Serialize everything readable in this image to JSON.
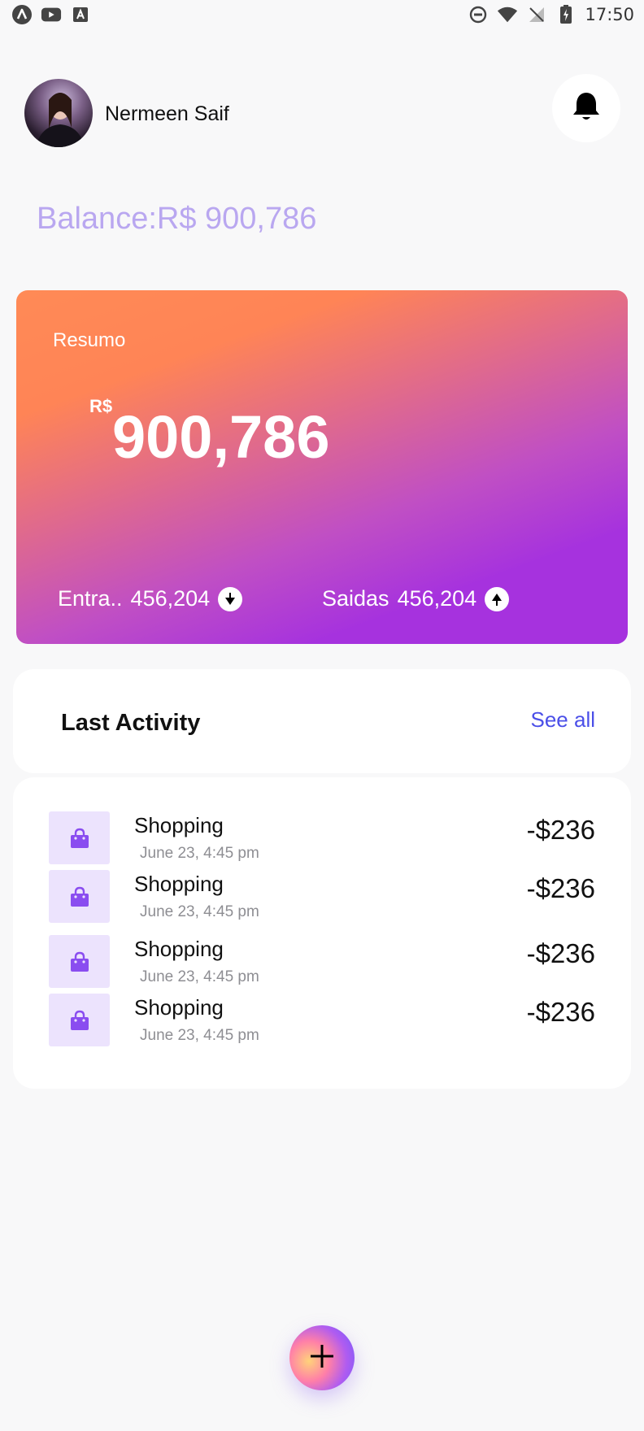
{
  "status_bar": {
    "time": "17:50",
    "left_icons": [
      "app-a-icon",
      "youtube-icon",
      "font-a-icon"
    ],
    "right_icons": [
      "dnd-icon",
      "wifi-icon",
      "no-signal-icon",
      "battery-charging-icon"
    ]
  },
  "header": {
    "user_name": "Nermeen Saif",
    "avatar": "user-avatar",
    "notification_icon": "bell-icon"
  },
  "balance_line": "Balance:R$ 900,786",
  "summary": {
    "title": "Resumo",
    "currency": "R$",
    "amount": "900,786",
    "income_label": "Entra..",
    "income_value": "456,204",
    "income_icon": "arrow-down-icon",
    "expense_label": "Saidas",
    "expense_value": "456,204",
    "expense_icon": "arrow-up-icon"
  },
  "activity": {
    "title": "Last Activity",
    "see_all": "See all",
    "transactions": [
      {
        "title": "Shopping",
        "date": "June 23, 4:45 pm",
        "amount": "-$236",
        "icon": "shopping-bag-icon"
      },
      {
        "title": "Shopping",
        "date": "June 23, 4:45 pm",
        "amount": "-$236",
        "icon": "shopping-bag-icon"
      },
      {
        "title": "Shopping",
        "date": "June 23, 4:45 pm",
        "amount": "-$236",
        "icon": "shopping-bag-icon"
      },
      {
        "title": "Shopping",
        "date": "June 23, 4:45 pm",
        "amount": "-$236",
        "icon": "shopping-bag-icon"
      }
    ]
  },
  "fab_icon": "plus-icon",
  "colors": {
    "accent": "#4b4fe8",
    "balance_text": "#b9a7f0",
    "card_gradient_start": "#ff8456",
    "card_gradient_end": "#a632de",
    "icon_bg": "#ece3fd",
    "icon_fg": "#8a4df0"
  }
}
